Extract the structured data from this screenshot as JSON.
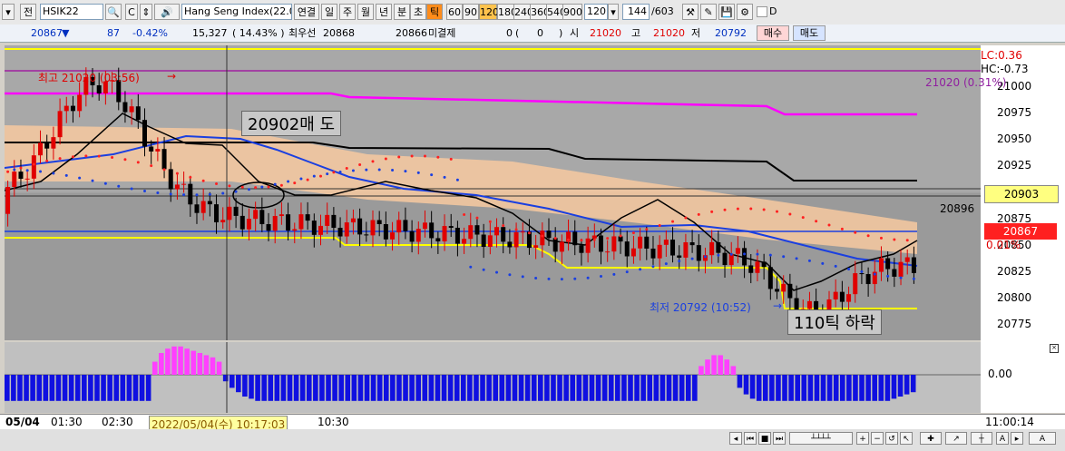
{
  "toolbar": {
    "all_btn": "전",
    "symbol_value": "HSIK22",
    "index_value": "Hang Seng Index(22.0",
    "link_label": "연결",
    "day_label": "일",
    "week_label": "주",
    "month_label": "월",
    "year_label": "년",
    "minute_label": "분",
    "second_label": "초",
    "tick_label": "틱",
    "periods": [
      "60",
      "90",
      "120",
      "180",
      "240",
      "360",
      "540",
      "900"
    ],
    "period_value": "120",
    "count_value": "144",
    "count_total": "/603",
    "checkbox_label": "D"
  },
  "quote": {
    "price": "20867",
    "change": "87",
    "change_pct": "-0.42%",
    "volume": "15,327",
    "volume_ratio": "( 14.43% )",
    "best_bid_label": "최우선",
    "best_bid": "20868",
    "best_ask": "20866",
    "unsettled_label": "미결제",
    "unsettled_value": "0",
    "unsettled_change": "0",
    "open_label": "시",
    "open": "21020",
    "high_label": "고",
    "high": "21020",
    "low_label": "저",
    "low": "20792",
    "buy_button": "매수",
    "sell_button": "매도"
  },
  "chart_data": {
    "type": "candlestick",
    "y_ticks": [
      "21000",
      "20975",
      "20950",
      "20925",
      "20875",
      "20850",
      "20825",
      "20800",
      "20775"
    ],
    "ylim": [
      20760,
      21040
    ],
    "lc": "LC:0.36",
    "hc": "HC:-0.73",
    "high_target": "21020 (0.31%)",
    "price_label_current": "20867",
    "price_label_current_pct": "0.01%",
    "price_label_yellow": "20903",
    "price_label_line": "20896",
    "high_annotation": "최고 21020 (03:56)",
    "low_annotation": "최저 20792 (10:52)",
    "note_sell": "20902매 도",
    "note_drop": "110틱 하락",
    "indicator_zero": "0.00",
    "time_labels": [
      "05/04",
      "01:30",
      "02:30",
      "2022/05/04(수) 10:17:03",
      "10:30",
      "11:00:14"
    ],
    "indicator_values": [
      -0.6,
      -0.6,
      -0.6,
      -0.6,
      -0.6,
      -0.6,
      -0.6,
      -0.6,
      -0.6,
      -0.6,
      -0.6,
      -0.6,
      -0.6,
      -0.6,
      -0.6,
      -0.6,
      -0.6,
      -0.6,
      -0.6,
      -0.6,
      -0.6,
      -0.6,
      -0.6,
      0.3,
      0.5,
      0.6,
      0.65,
      0.65,
      0.6,
      0.55,
      0.5,
      0.45,
      0.4,
      0.3,
      -0.15,
      -0.3,
      -0.4,
      -0.5,
      -0.55,
      -0.6,
      -0.6,
      -0.6,
      -0.6,
      -0.6,
      -0.6,
      -0.6,
      -0.6,
      -0.6,
      -0.6,
      -0.6,
      -0.6,
      -0.6,
      -0.6,
      -0.6,
      -0.6,
      -0.6,
      -0.6,
      -0.6,
      -0.6,
      -0.6,
      -0.6,
      -0.6,
      -0.6,
      -0.6,
      -0.6,
      -0.6,
      -0.6,
      -0.6,
      -0.6,
      -0.6,
      -0.6,
      -0.6,
      -0.6,
      -0.6,
      -0.6,
      -0.6,
      -0.6,
      -0.6,
      -0.6,
      -0.6,
      -0.6,
      -0.6,
      -0.6,
      -0.6,
      -0.6,
      -0.6,
      -0.6,
      -0.6,
      -0.6,
      -0.6,
      -0.6,
      -0.6,
      -0.6,
      -0.6,
      -0.6,
      -0.6,
      -0.6,
      -0.6,
      -0.6,
      -0.6,
      -0.6,
      -0.6,
      -0.6,
      -0.6,
      -0.6,
      -0.6,
      -0.6,
      -0.6,
      0.2,
      0.35,
      0.45,
      0.45,
      0.35,
      0.2,
      -0.3,
      -0.45,
      -0.55,
      -0.6,
      -0.6,
      -0.6,
      -0.6,
      -0.6,
      -0.6,
      -0.6,
      -0.6,
      -0.6,
      -0.6,
      -0.6,
      -0.6,
      -0.6,
      -0.6,
      -0.6,
      -0.6,
      -0.6,
      -0.6,
      -0.6,
      -0.6,
      -0.6,
      -0.55,
      -0.5,
      -0.45,
      -0.4
    ]
  },
  "colors": {
    "up": "#e00000",
    "down": "#000000",
    "magenta_band": "#ff00ff",
    "yellow_band": "#ffff00",
    "ma_blue": "#1a3fe0",
    "indicator_pos": "#ff40ff",
    "indicator_neg": "#1010e0"
  }
}
